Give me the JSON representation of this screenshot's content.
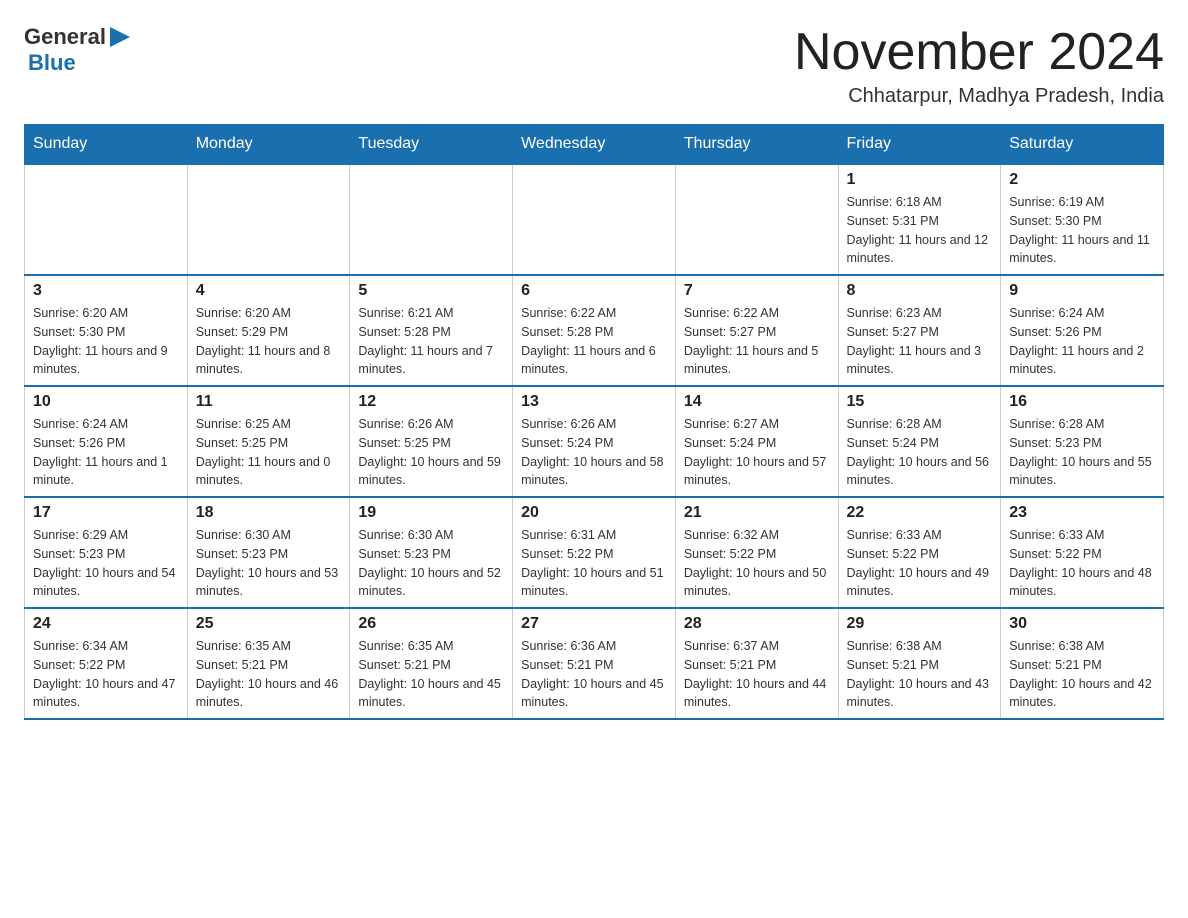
{
  "header": {
    "logo_general": "General",
    "logo_blue": "Blue",
    "month_title": "November 2024",
    "location": "Chhatarpur, Madhya Pradesh, India"
  },
  "days_of_week": [
    "Sunday",
    "Monday",
    "Tuesday",
    "Wednesday",
    "Thursday",
    "Friday",
    "Saturday"
  ],
  "weeks": [
    [
      {
        "day": "",
        "sunrise": "",
        "sunset": "",
        "daylight": ""
      },
      {
        "day": "",
        "sunrise": "",
        "sunset": "",
        "daylight": ""
      },
      {
        "day": "",
        "sunrise": "",
        "sunset": "",
        "daylight": ""
      },
      {
        "day": "",
        "sunrise": "",
        "sunset": "",
        "daylight": ""
      },
      {
        "day": "",
        "sunrise": "",
        "sunset": "",
        "daylight": ""
      },
      {
        "day": "1",
        "sunrise": "Sunrise: 6:18 AM",
        "sunset": "Sunset: 5:31 PM",
        "daylight": "Daylight: 11 hours and 12 minutes."
      },
      {
        "day": "2",
        "sunrise": "Sunrise: 6:19 AM",
        "sunset": "Sunset: 5:30 PM",
        "daylight": "Daylight: 11 hours and 11 minutes."
      }
    ],
    [
      {
        "day": "3",
        "sunrise": "Sunrise: 6:20 AM",
        "sunset": "Sunset: 5:30 PM",
        "daylight": "Daylight: 11 hours and 9 minutes."
      },
      {
        "day": "4",
        "sunrise": "Sunrise: 6:20 AM",
        "sunset": "Sunset: 5:29 PM",
        "daylight": "Daylight: 11 hours and 8 minutes."
      },
      {
        "day": "5",
        "sunrise": "Sunrise: 6:21 AM",
        "sunset": "Sunset: 5:28 PM",
        "daylight": "Daylight: 11 hours and 7 minutes."
      },
      {
        "day": "6",
        "sunrise": "Sunrise: 6:22 AM",
        "sunset": "Sunset: 5:28 PM",
        "daylight": "Daylight: 11 hours and 6 minutes."
      },
      {
        "day": "7",
        "sunrise": "Sunrise: 6:22 AM",
        "sunset": "Sunset: 5:27 PM",
        "daylight": "Daylight: 11 hours and 5 minutes."
      },
      {
        "day": "8",
        "sunrise": "Sunrise: 6:23 AM",
        "sunset": "Sunset: 5:27 PM",
        "daylight": "Daylight: 11 hours and 3 minutes."
      },
      {
        "day": "9",
        "sunrise": "Sunrise: 6:24 AM",
        "sunset": "Sunset: 5:26 PM",
        "daylight": "Daylight: 11 hours and 2 minutes."
      }
    ],
    [
      {
        "day": "10",
        "sunrise": "Sunrise: 6:24 AM",
        "sunset": "Sunset: 5:26 PM",
        "daylight": "Daylight: 11 hours and 1 minute."
      },
      {
        "day": "11",
        "sunrise": "Sunrise: 6:25 AM",
        "sunset": "Sunset: 5:25 PM",
        "daylight": "Daylight: 11 hours and 0 minutes."
      },
      {
        "day": "12",
        "sunrise": "Sunrise: 6:26 AM",
        "sunset": "Sunset: 5:25 PM",
        "daylight": "Daylight: 10 hours and 59 minutes."
      },
      {
        "day": "13",
        "sunrise": "Sunrise: 6:26 AM",
        "sunset": "Sunset: 5:24 PM",
        "daylight": "Daylight: 10 hours and 58 minutes."
      },
      {
        "day": "14",
        "sunrise": "Sunrise: 6:27 AM",
        "sunset": "Sunset: 5:24 PM",
        "daylight": "Daylight: 10 hours and 57 minutes."
      },
      {
        "day": "15",
        "sunrise": "Sunrise: 6:28 AM",
        "sunset": "Sunset: 5:24 PM",
        "daylight": "Daylight: 10 hours and 56 minutes."
      },
      {
        "day": "16",
        "sunrise": "Sunrise: 6:28 AM",
        "sunset": "Sunset: 5:23 PM",
        "daylight": "Daylight: 10 hours and 55 minutes."
      }
    ],
    [
      {
        "day": "17",
        "sunrise": "Sunrise: 6:29 AM",
        "sunset": "Sunset: 5:23 PM",
        "daylight": "Daylight: 10 hours and 54 minutes."
      },
      {
        "day": "18",
        "sunrise": "Sunrise: 6:30 AM",
        "sunset": "Sunset: 5:23 PM",
        "daylight": "Daylight: 10 hours and 53 minutes."
      },
      {
        "day": "19",
        "sunrise": "Sunrise: 6:30 AM",
        "sunset": "Sunset: 5:23 PM",
        "daylight": "Daylight: 10 hours and 52 minutes."
      },
      {
        "day": "20",
        "sunrise": "Sunrise: 6:31 AM",
        "sunset": "Sunset: 5:22 PM",
        "daylight": "Daylight: 10 hours and 51 minutes."
      },
      {
        "day": "21",
        "sunrise": "Sunrise: 6:32 AM",
        "sunset": "Sunset: 5:22 PM",
        "daylight": "Daylight: 10 hours and 50 minutes."
      },
      {
        "day": "22",
        "sunrise": "Sunrise: 6:33 AM",
        "sunset": "Sunset: 5:22 PM",
        "daylight": "Daylight: 10 hours and 49 minutes."
      },
      {
        "day": "23",
        "sunrise": "Sunrise: 6:33 AM",
        "sunset": "Sunset: 5:22 PM",
        "daylight": "Daylight: 10 hours and 48 minutes."
      }
    ],
    [
      {
        "day": "24",
        "sunrise": "Sunrise: 6:34 AM",
        "sunset": "Sunset: 5:22 PM",
        "daylight": "Daylight: 10 hours and 47 minutes."
      },
      {
        "day": "25",
        "sunrise": "Sunrise: 6:35 AM",
        "sunset": "Sunset: 5:21 PM",
        "daylight": "Daylight: 10 hours and 46 minutes."
      },
      {
        "day": "26",
        "sunrise": "Sunrise: 6:35 AM",
        "sunset": "Sunset: 5:21 PM",
        "daylight": "Daylight: 10 hours and 45 minutes."
      },
      {
        "day": "27",
        "sunrise": "Sunrise: 6:36 AM",
        "sunset": "Sunset: 5:21 PM",
        "daylight": "Daylight: 10 hours and 45 minutes."
      },
      {
        "day": "28",
        "sunrise": "Sunrise: 6:37 AM",
        "sunset": "Sunset: 5:21 PM",
        "daylight": "Daylight: 10 hours and 44 minutes."
      },
      {
        "day": "29",
        "sunrise": "Sunrise: 6:38 AM",
        "sunset": "Sunset: 5:21 PM",
        "daylight": "Daylight: 10 hours and 43 minutes."
      },
      {
        "day": "30",
        "sunrise": "Sunrise: 6:38 AM",
        "sunset": "Sunset: 5:21 PM",
        "daylight": "Daylight: 10 hours and 42 minutes."
      }
    ]
  ]
}
